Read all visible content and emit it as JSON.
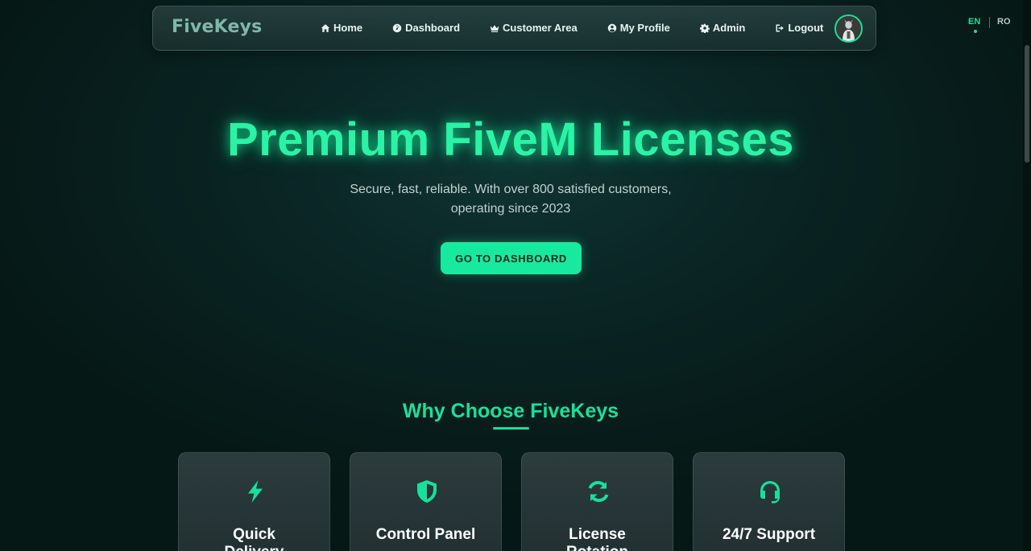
{
  "nav": {
    "logo": "FiveKeys",
    "items": [
      {
        "label": "Home",
        "icon": "home-icon"
      },
      {
        "label": "Dashboard",
        "icon": "dashboard-icon"
      },
      {
        "label": "Customer Area",
        "icon": "crown-icon"
      },
      {
        "label": "My Profile",
        "icon": "user-circle-icon"
      },
      {
        "label": "Admin",
        "icon": "gear-icon"
      },
      {
        "label": "Logout",
        "icon": "logout-icon"
      }
    ]
  },
  "lang": {
    "en": "EN",
    "ro": "RO",
    "active": "EN"
  },
  "hero": {
    "title": "Premium FiveM Licenses",
    "subtitle": "Secure, fast, reliable. With over 800 satisfied customers, operating since 2023",
    "cta": "GO TO DASHBOARD"
  },
  "features": {
    "title": "Why Choose FiveKeys",
    "cards": [
      {
        "title": "Quick Delivery",
        "icon": "lightning-icon"
      },
      {
        "title": "Control Panel",
        "icon": "shield-icon"
      },
      {
        "title": "License Rotation",
        "icon": "refresh-icon"
      },
      {
        "title": "24/7 Support",
        "icon": "headset-icon"
      }
    ]
  },
  "colors": {
    "accent": "#18e09b",
    "background": "#071b1a",
    "button_text": "#062a20"
  }
}
